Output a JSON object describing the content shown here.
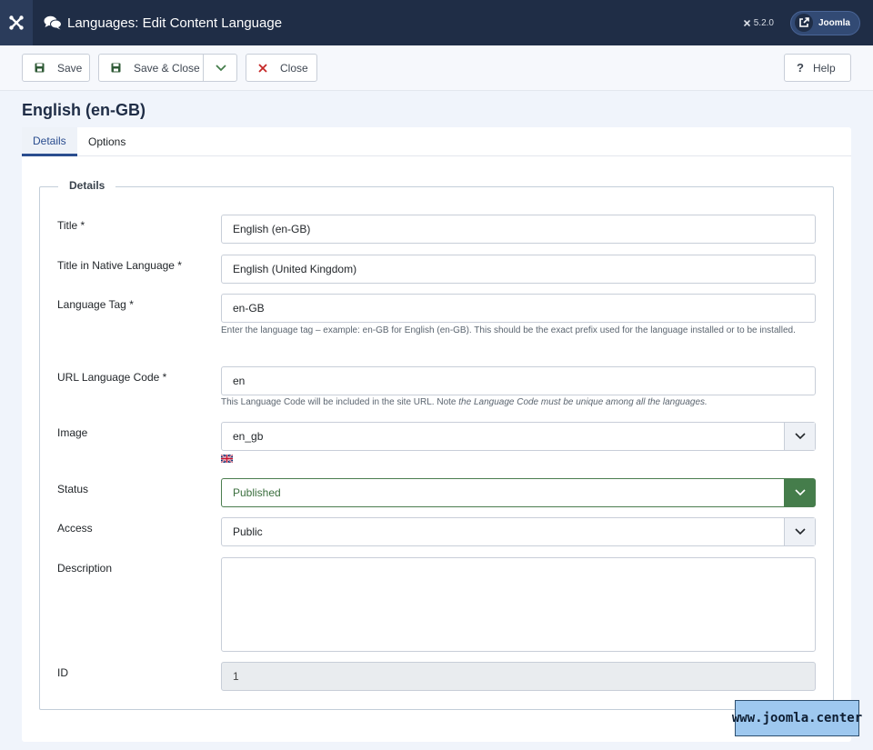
{
  "header": {
    "title": "Languages: Edit Content Language",
    "version": "5.2.0",
    "site_link": "Joomla"
  },
  "toolbar": {
    "save_label": "Save",
    "save_close_label": "Save & Close",
    "close_label": "Close",
    "help_label": "Help"
  },
  "form": {
    "heading": "English (en-GB)",
    "tabs": [
      {
        "label": "Details"
      },
      {
        "label": "Options"
      }
    ],
    "fieldset_legend": "Details",
    "fields": {
      "title": {
        "label": "Title *",
        "value": "English (en-GB)"
      },
      "native_title": {
        "label": "Title in Native Language *",
        "value": "English (United Kingdom)"
      },
      "lang_tag": {
        "label": "Language Tag *",
        "value": "en-GB",
        "help": "Enter the language tag – example: en-GB for English (en-GB). This should be the exact prefix used for the language installed or to be installed."
      },
      "url_code": {
        "label": "URL Language Code *",
        "value": "en",
        "help_plain": "This Language Code will be included in the site URL. Note ",
        "help_em": "the Language Code must be unique among all the languages."
      },
      "image": {
        "label": "Image",
        "value": "en_gb"
      },
      "status": {
        "label": "Status",
        "value": "Published"
      },
      "access": {
        "label": "Access",
        "value": "Public"
      },
      "description": {
        "label": "Description",
        "value": ""
      },
      "id": {
        "label": "ID",
        "value": "1"
      }
    }
  },
  "watermark": "www.joomla.center",
  "colors": {
    "header_bg": "#1f2d46",
    "accent": "#2a4d8f",
    "status_green": "#457d4b",
    "danger": "#c52827"
  }
}
